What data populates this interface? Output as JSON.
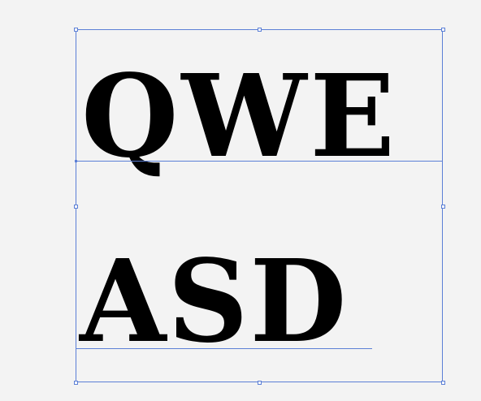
{
  "text_frame": {
    "lines": [
      "QWE",
      "ASD"
    ]
  },
  "colors": {
    "selection": "#5b7fd6",
    "canvas_background": "#f3f3f3",
    "text": "#000000"
  }
}
